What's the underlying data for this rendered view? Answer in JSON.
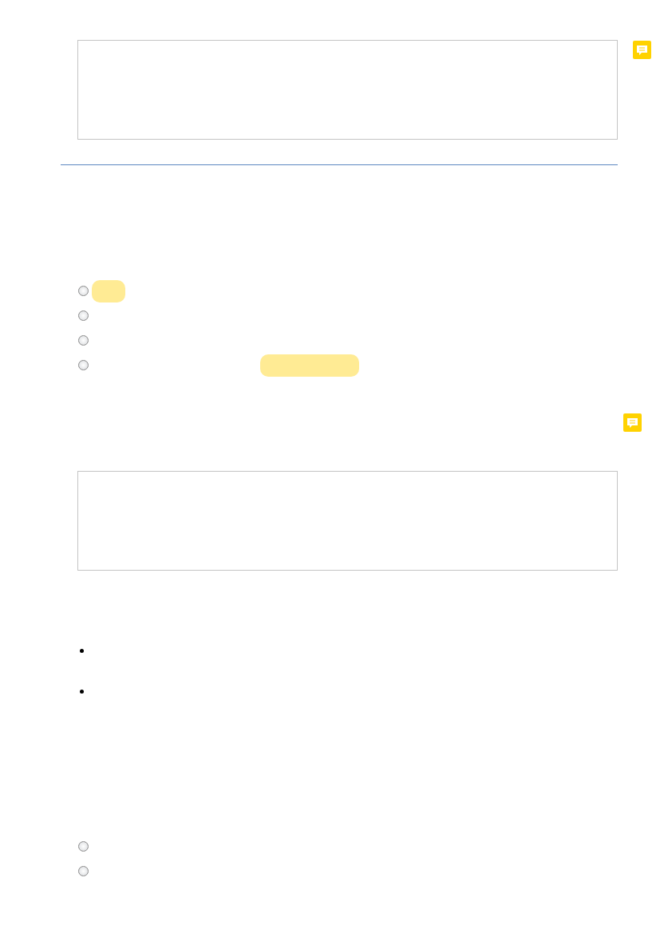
{
  "answer_boxes": [
    {
      "has_comment": true
    },
    {
      "has_comment": false
    }
  ],
  "question_1": {
    "has_comment": true,
    "options": [
      {
        "selected": false,
        "highlighted": true
      },
      {
        "selected": false,
        "highlighted": false
      },
      {
        "selected": false,
        "highlighted": false
      },
      {
        "selected": false,
        "highlighted": true
      }
    ]
  },
  "bullets": [
    {
      "kind": "bullet"
    },
    {
      "kind": "bullet"
    }
  ],
  "question_2": {
    "options": [
      {
        "selected": false
      },
      {
        "selected": false
      }
    ]
  }
}
